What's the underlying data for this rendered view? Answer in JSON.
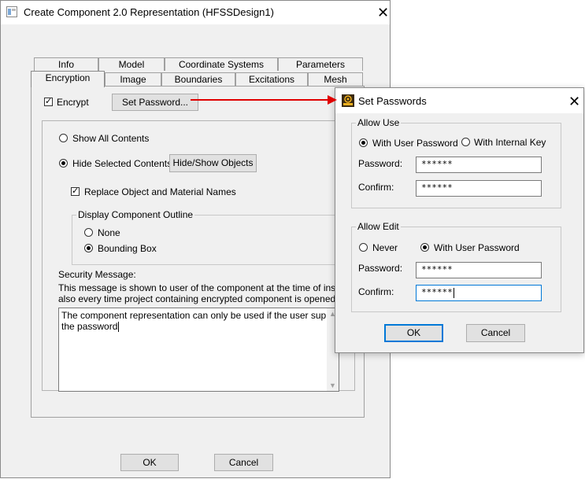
{
  "main_dialog": {
    "title": "Create Component 2.0 Representation (HFSSDesign1)",
    "tabs_row1": [
      "Info",
      "Model",
      "Coordinate Systems",
      "Parameters"
    ],
    "tabs_row2": [
      "Encryption",
      "Image",
      "Boundaries",
      "Excitations",
      "Mesh"
    ],
    "selected_tab": "Encryption",
    "encrypt_label": "Encrypt",
    "encrypt_checked": true,
    "set_password_label": "Set Password...",
    "show_all_label": "Show All Contents",
    "hide_selected_label": "Hide Selected Contents",
    "hide_show_objects_label": "Hide/Show Objects",
    "replace_names_label": "Replace Object and Material Names",
    "outline_group_title": "Display Component Outline",
    "outline_none_label": "None",
    "outline_bbox_label": "Bounding Box",
    "security_title": "Security Message:",
    "security_desc_line1": "This message is shown to user of the component at the time of insert and",
    "security_desc_line2": "also every time project containing encrypted component is opened.",
    "security_message_line1": "The component representation can only be used if the user supplies",
    "security_message_line2": "the password",
    "ok_label": "OK",
    "cancel_label": "Cancel"
  },
  "passwords_dialog": {
    "title": "Set Passwords",
    "allow_use_title": "Allow Use",
    "with_user_password_label": "With User Password",
    "with_internal_key_label": "With Internal Key",
    "password_label": "Password:",
    "confirm_label": "Confirm:",
    "use_password_value": "******",
    "use_confirm_value": "******",
    "allow_edit_title": "Allow Edit",
    "never_label": "Never",
    "edit_with_user_password_label": "With User Password",
    "edit_password_value": "******",
    "edit_confirm_value": "******",
    "ok_label": "OK",
    "cancel_label": "Cancel"
  },
  "colors": {
    "arrow": "#e00000",
    "focus_border": "#0078d7"
  }
}
